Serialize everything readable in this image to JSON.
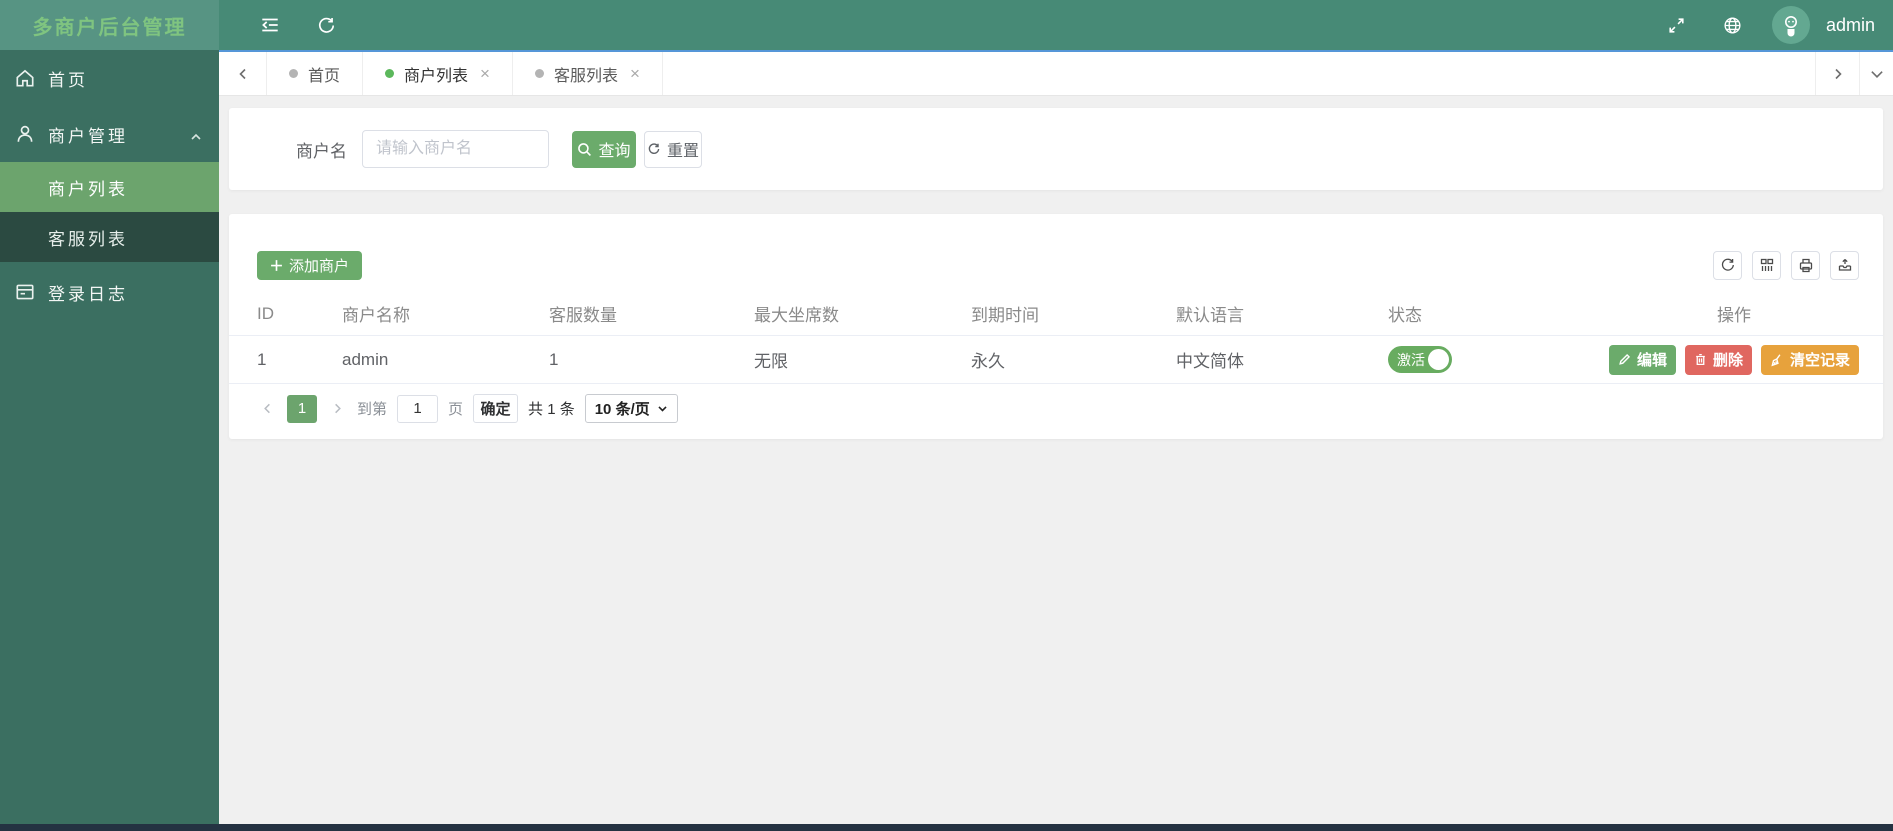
{
  "app": {
    "title": "多商户后台管理",
    "user": "admin"
  },
  "sidebar": {
    "items": [
      {
        "label": "首页",
        "icon": "home-icon"
      },
      {
        "label": "商户管理",
        "icon": "user-icon",
        "expanded": true,
        "children": [
          {
            "label": "商户列表",
            "active": true
          },
          {
            "label": "客服列表",
            "active": false
          }
        ]
      },
      {
        "label": "登录日志",
        "icon": "log-icon"
      }
    ]
  },
  "tabs": [
    {
      "label": "首页",
      "active": false,
      "closable": false
    },
    {
      "label": "商户列表",
      "active": true,
      "closable": true
    },
    {
      "label": "客服列表",
      "active": false,
      "closable": true
    }
  ],
  "search": {
    "label": "商户名",
    "placeholder": "请输入商户名",
    "query_button": "查询",
    "reset_button": "重置"
  },
  "toolbar": {
    "add_button": "添加商户"
  },
  "table": {
    "columns": [
      "ID",
      "商户名称",
      "客服数量",
      "最大坐席数",
      "到期时间",
      "默认语言",
      "状态",
      "操作"
    ],
    "rows": [
      {
        "id": "1",
        "name": "admin",
        "agents": "1",
        "max_seats": "无限",
        "expire": "永久",
        "language": "中文简体",
        "status": "激活",
        "status_on": true,
        "actions": {
          "edit": "编辑",
          "delete": "删除",
          "clear": "清空记录"
        }
      }
    ]
  },
  "pagination": {
    "current_page": "1",
    "goto_label": "到第",
    "goto_value": "1",
    "page_label": "页",
    "confirm": "确定",
    "total": "共 1 条",
    "page_size": "10 条/页"
  },
  "icons": {
    "close": "×"
  },
  "colors": {
    "topbar_green": "#478a76",
    "logo_green": "#579483",
    "sidebar_green": "#3b6f61",
    "submenu_dark": "#2b4a41",
    "active_item_green": "#6ca46d",
    "primary_green": "#6bab6b",
    "danger_red": "#e06760",
    "warning_orange": "#e7a23c",
    "toggle_green": "#68ac60",
    "divider_blue": "#5596d8",
    "tab_dot_active": "#5cb85c",
    "tab_dot_inactive": "#b4b4b4"
  }
}
